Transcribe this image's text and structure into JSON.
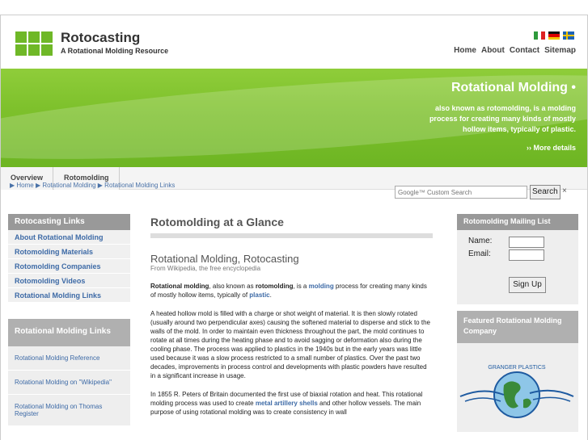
{
  "header": {
    "brand_title": "Rotocasting",
    "brand_subtitle": "A Rotational Molding Resource",
    "nav": [
      "Home",
      "About",
      "Contact",
      "Sitemap"
    ],
    "accent": "#6fb827"
  },
  "banner": {
    "title": "Rotational Molding •",
    "text": "also known as rotomolding, is a molding process for creating many kinds of mostly hollow items, typically of plastic.",
    "more": "›› More details"
  },
  "tabs": [
    "Overview",
    "Rotomolding"
  ],
  "breadcrumb": "▶ Home ▶ Rotational Molding ▶ Rotational Molding Links",
  "search": {
    "placeholder": "Google™ Custom Search",
    "button": "Search",
    "close": "×"
  },
  "left_sidebar": {
    "heading": "Rotocasting Links",
    "items": [
      "About Rotational Molding",
      "Rotomolding Materials",
      "Rotomolding Companies",
      "Rotomolding Videos",
      "Rotational Molding Links"
    ],
    "heading2": "Rotational Molding Links",
    "links": [
      "Rotational Molding Reference",
      "Rotational Molding on \"Wikipedia\"",
      "Rotational Molding on Thomas Register"
    ]
  },
  "main": {
    "heading": "Rotomolding at a Glance",
    "subheading": "Rotational Molding, Rotocasting",
    "source": "From Wikipedia, the free encyclopedia",
    "p1_a": "Rotational molding",
    "p1_b": ", also known as ",
    "p1_c": "rotomolding",
    "p1_d": ", is a ",
    "p1_e": "molding",
    "p1_f": " process for creating many kinds of mostly hollow items, typically of ",
    "p1_g": "plastic",
    "p1_h": ".",
    "p2": "A heated hollow mold is filled with a charge or shot weight of material. It is then slowly rotated (usually around two perpendicular axes) causing the softened material to disperse and stick to the walls of the mold. In order to maintain even thickness throughout the part, the mold continues to rotate at all times during the heating phase and to avoid sagging or deformation also during the cooling phase. The process was applied to plastics in the 1940s but in the early years was little used because it was a slow process restricted to a small number of plastics. Over the past two decades, improvements in process control and developments with plastic powders have resulted in a significant increase in usage.",
    "p3_a": "In 1855 R. Peters of Britain documented the first use of biaxial rotation and heat. This rotational molding process was used to create ",
    "p3_b": "metal artillery shells",
    "p3_c": " and other hollow vessels. The main purpose of using rotational molding was to create consistency in wall"
  },
  "right_sidebar": {
    "heading": "Rotomolding Mailing List",
    "name_label": "Name:",
    "email_label": "Email:",
    "button": "Sign Up",
    "heading2": "Featured Rotational Molding Company",
    "logo_text": "GRANGER PLASTICS"
  }
}
